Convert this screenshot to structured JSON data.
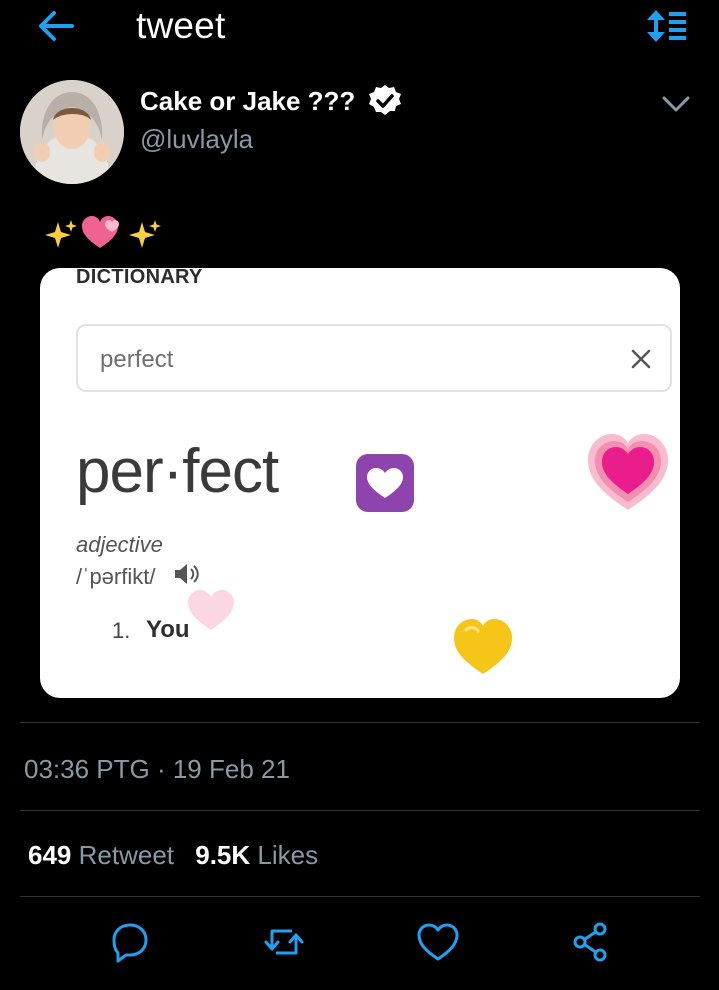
{
  "header": {
    "title": "tweet",
    "back_icon": "arrow-left-icon",
    "sort_icon": "sort-icon",
    "accent_color": "#1da1f2"
  },
  "author": {
    "name": "Cake or Jake ???",
    "handle": "@luvlayla",
    "verified": true
  },
  "tweet": {
    "emojis": [
      "sparkles",
      "revolving-hearts",
      "sparkles"
    ]
  },
  "media": {
    "dictionary_label": "DICTIONARY",
    "search_value": "perfect",
    "word": "per·fect",
    "part_of_speech": "adjective",
    "pronunciation": "/ˈpərfikt/",
    "definition_number": "1.",
    "definition": "You"
  },
  "meta": {
    "timestamp": "03:36 PTG · 19 Feb 21"
  },
  "stats": {
    "retweets_count": "649",
    "retweets_label": "Retweet",
    "likes_count": "9.5K",
    "likes_label": "Likes"
  },
  "actions": [
    "reply-icon",
    "retweet-icon",
    "like-icon",
    "share-icon"
  ]
}
